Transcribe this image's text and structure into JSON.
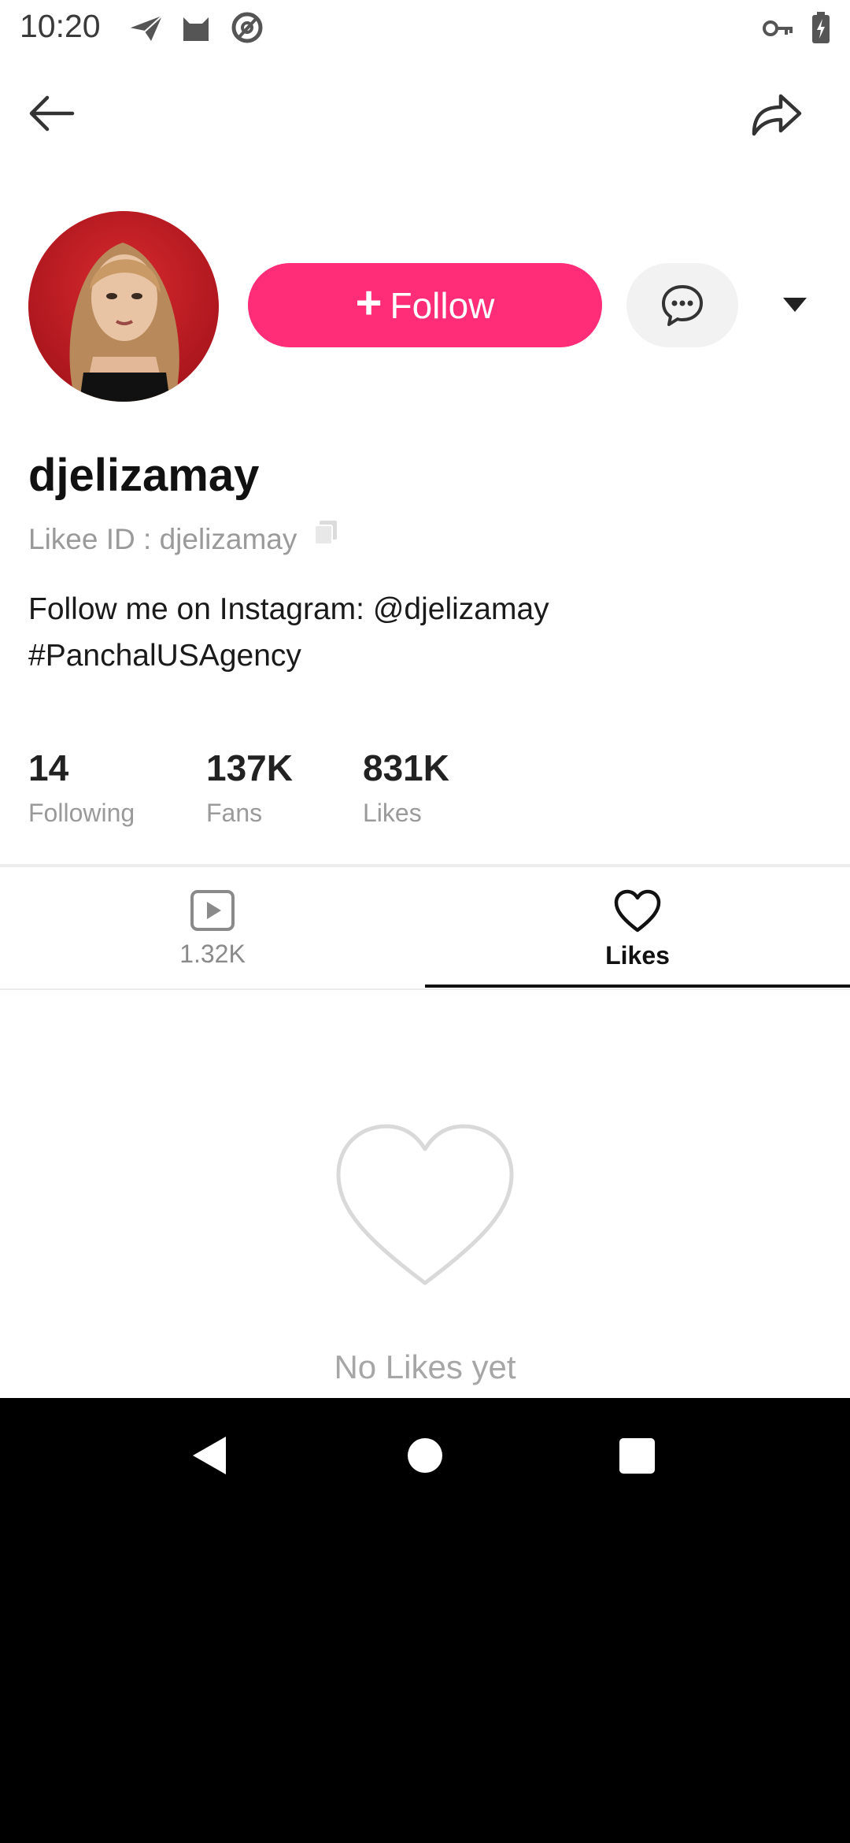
{
  "status_bar": {
    "time": "10:20",
    "icons": [
      "send-icon",
      "cat-icon",
      "at-sign-icon",
      "key-icon",
      "battery-charging-icon"
    ]
  },
  "toolbar": {
    "back_icon": "arrow-left-icon",
    "share_icon": "share-arrow-icon"
  },
  "profile": {
    "username": "djelizamay",
    "likee_id": "Likee ID : djelizamay",
    "bio_line1": "Follow me on Instagram: @djelizamay",
    "bio_line2": "#PanchalUSAgency",
    "follow_label": "Follow",
    "follow_color": "#ff2c77"
  },
  "stats": [
    {
      "value": "14",
      "label": "Following"
    },
    {
      "value": "137K",
      "label": "Fans"
    },
    {
      "value": "831K",
      "label": "Likes"
    }
  ],
  "tabs": [
    {
      "label": "1.32K",
      "icon": "video-play-icon",
      "active": false
    },
    {
      "label": "Likes",
      "icon": "heart-icon",
      "active": true
    }
  ],
  "empty_state": {
    "text": "No Likes yet",
    "icon": "heart-outline-icon"
  },
  "nav_bar": {
    "icons": [
      "nav-back-icon",
      "nav-home-icon",
      "nav-recents-icon"
    ]
  }
}
